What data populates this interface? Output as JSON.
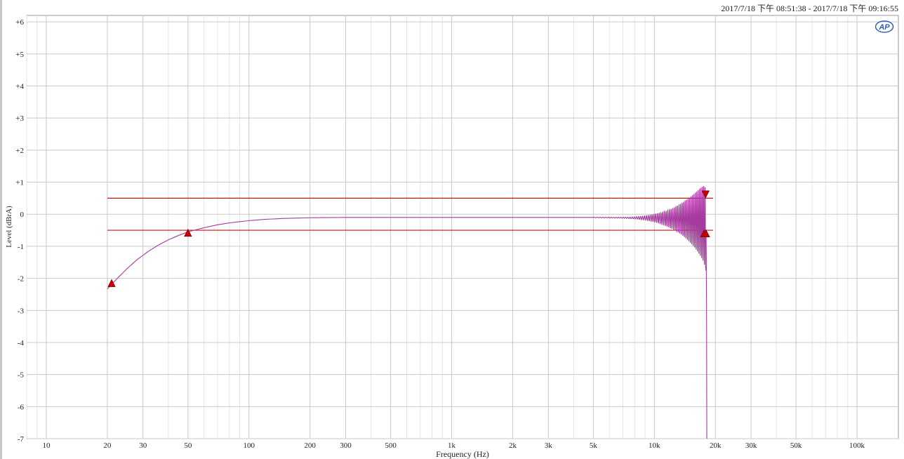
{
  "header": {
    "timestamp": "2017/7/18 下午 08:51:38 - 2017/7/18 下午 09:16:55"
  },
  "logo": {
    "text": "AP"
  },
  "colors": {
    "trace": "#a63a9e",
    "limit": "#cc1111",
    "marker": "#cc0000",
    "grid_major": "#c9c9c9",
    "grid_minor": "#e4e4e4"
  },
  "chart_data": {
    "type": "line",
    "xlabel": "Frequency (Hz)",
    "ylabel": "Level (dBrA)",
    "xscale": "log",
    "xlim": [
      8,
      160000
    ],
    "ylim": [
      -7,
      6.2
    ],
    "grid": true,
    "x_ticks": [
      10,
      20,
      30,
      50,
      100,
      200,
      300,
      500,
      1000,
      2000,
      3000,
      5000,
      10000,
      20000,
      30000,
      50000,
      100000
    ],
    "x_tick_labels": [
      "10",
      "20",
      "30",
      "50",
      "100",
      "200",
      "300",
      "500",
      "1k",
      "2k",
      "3k",
      "5k",
      "10k",
      "20k",
      "30k",
      "50k",
      "100k"
    ],
    "y_ticks": [
      6,
      5,
      4,
      3,
      2,
      1,
      0,
      -1,
      -2,
      -3,
      -4,
      -5,
      -6,
      -7
    ],
    "y_tick_labels": [
      "+6",
      "+5",
      "+4",
      "+3",
      "+2",
      "+1",
      "0",
      "-1",
      "-2",
      "-3",
      "-4",
      "-5",
      "-6",
      "-7"
    ],
    "limit_lines": [
      {
        "level": 0.5,
        "x_range": [
          20,
          19500
        ]
      },
      {
        "level": -0.5,
        "x_range": [
          20,
          19500
        ]
      }
    ],
    "series": [
      {
        "points": [
          [
            20,
            -2.33
          ],
          [
            22,
            -2.05
          ],
          [
            25,
            -1.7
          ],
          [
            28,
            -1.42
          ],
          [
            32,
            -1.15
          ],
          [
            36,
            -0.95
          ],
          [
            40,
            -0.8
          ],
          [
            45,
            -0.66
          ],
          [
            50,
            -0.55
          ],
          [
            60,
            -0.42
          ],
          [
            70,
            -0.33
          ],
          [
            80,
            -0.27
          ],
          [
            100,
            -0.2
          ],
          [
            120,
            -0.16
          ],
          [
            150,
            -0.13
          ],
          [
            200,
            -0.11
          ],
          [
            300,
            -0.1
          ],
          [
            500,
            -0.1
          ],
          [
            1000,
            -0.1
          ],
          [
            2000,
            -0.1
          ],
          [
            5000,
            -0.1
          ],
          [
            10000,
            -0.12
          ],
          [
            14000,
            -0.15
          ],
          [
            16000,
            -0.2
          ],
          [
            17000,
            -0.25
          ],
          [
            17500,
            -0.3
          ],
          [
            17800,
            -0.4
          ],
          [
            18000,
            -0.5
          ],
          [
            18100,
            -3
          ],
          [
            18150,
            -7
          ]
        ],
        "ripple": {
          "start": 5000,
          "end": 18000,
          "min_amp": 0.01,
          "max_amp": 1.3,
          "cycles": 60
        }
      }
    ],
    "markers": [
      {
        "x": 21,
        "y": -2.15,
        "dir": "up"
      },
      {
        "x": 50,
        "y": -0.58,
        "dir": "up"
      },
      {
        "x": 17600,
        "y": -0.6,
        "dir": "up"
      },
      {
        "x": 18000,
        "y": -0.6,
        "dir": "up"
      },
      {
        "x": 17900,
        "y": 0.62,
        "dir": "down"
      }
    ]
  }
}
